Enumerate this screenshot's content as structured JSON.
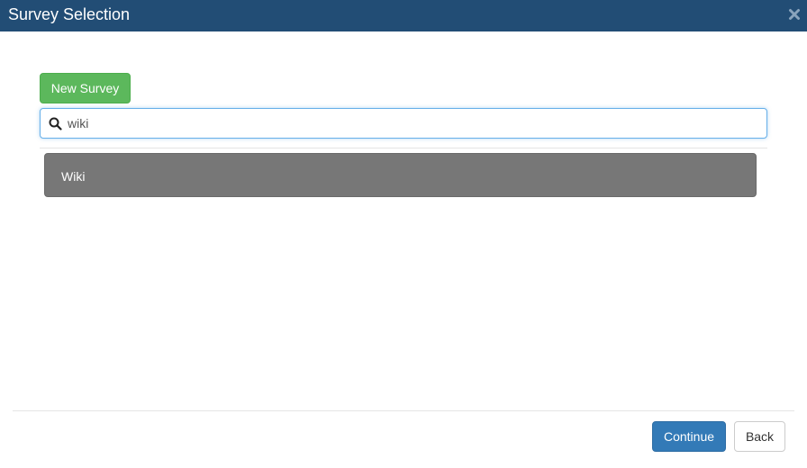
{
  "dialog": {
    "title": "Survey Selection",
    "close_icon": "close-icon"
  },
  "toolbar": {
    "new_survey_label": "New Survey"
  },
  "search": {
    "icon": "search-icon",
    "value": "wiki"
  },
  "results": [
    {
      "label": "Wiki"
    }
  ],
  "footer": {
    "continue_label": "Continue",
    "back_label": "Back"
  },
  "colors": {
    "titlebar": "#224d75",
    "new_survey": "#5cb85c",
    "continue": "#337ab7",
    "result_selected": "#777777",
    "search_focus": "#66afe9"
  }
}
